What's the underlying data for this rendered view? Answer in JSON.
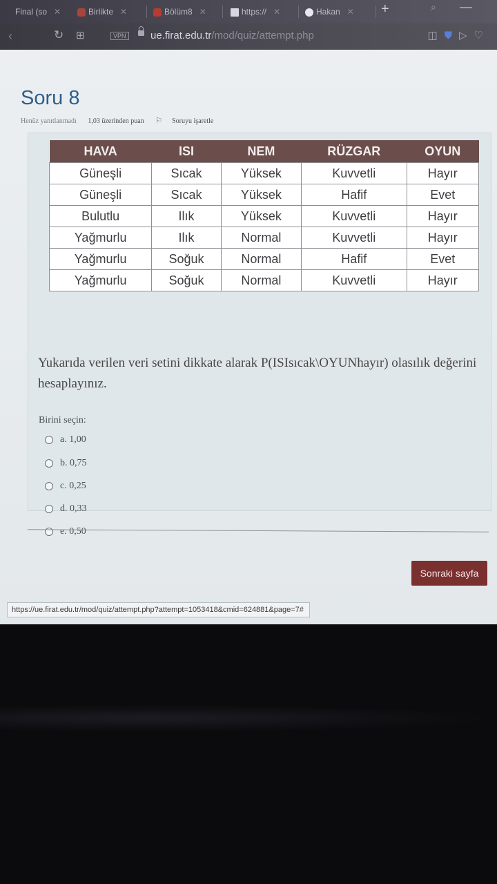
{
  "browser": {
    "tabs": [
      {
        "label": "Final (so"
      },
      {
        "label": "Birlikte"
      },
      {
        "label": "Bölüm8"
      },
      {
        "label": "https://"
      },
      {
        "label": "Hakan"
      }
    ],
    "url_host": "ue.firat.edu.tr",
    "url_path": "/mod/quiz/attempt.php",
    "vpn_label": "VPN"
  },
  "question": {
    "title": "Soru 8",
    "status": "Henüz yanıtlanmadı",
    "points": "1,03 üzerinden puan",
    "flag_label": "Soruyu işaretle",
    "table": {
      "headers": [
        "HAVA",
        "ISI",
        "NEM",
        "RÜZGAR",
        "OYUN"
      ],
      "rows": [
        [
          "Güneşli",
          "Sıcak",
          "Yüksek",
          "Kuvvetli",
          "Hayır"
        ],
        [
          "Güneşli",
          "Sıcak",
          "Yüksek",
          "Hafif",
          "Evet"
        ],
        [
          "Bulutlu",
          "Ilık",
          "Yüksek",
          "Kuvvetli",
          "Hayır"
        ],
        [
          "Yağmurlu",
          "Ilık",
          "Normal",
          "Kuvvetli",
          "Hayır"
        ],
        [
          "Yağmurlu",
          "Soğuk",
          "Normal",
          "Hafif",
          "Evet"
        ],
        [
          "Yağmurlu",
          "Soğuk",
          "Normal",
          "Kuvvetli",
          "Hayır"
        ]
      ]
    },
    "text": "Yukarıda verilen veri setini dikkate alarak P(ISIsıcak\\OYUNhayır) olasılık değerini hesaplayınız.",
    "choose_label": "Birini seçin:",
    "options": [
      {
        "label": "a. 1,00"
      },
      {
        "label": "b. 0,75"
      },
      {
        "label": "c. 0,25"
      },
      {
        "label": "d. 0,33"
      },
      {
        "label": "e. 0,50"
      }
    ]
  },
  "footer": {
    "next_label": "Sonraki sayfa",
    "status_url": "https://ue.firat.edu.tr/mod/quiz/attempt.php?attempt=1053418&cmid=624881&page=7#"
  }
}
